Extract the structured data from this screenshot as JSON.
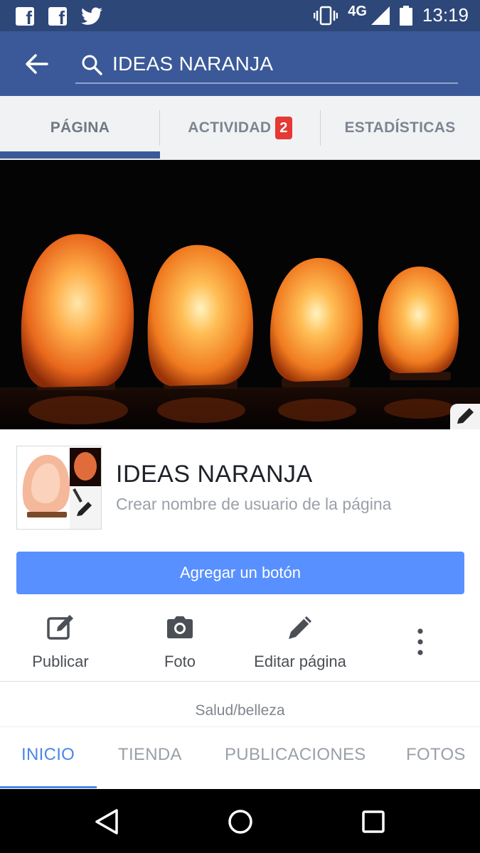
{
  "status_bar": {
    "network": "4G",
    "time": "13:19",
    "icons": [
      "facebook-icon",
      "facebook-icon",
      "twitter-icon",
      "vibrate-icon",
      "signal-icon",
      "battery-icon"
    ]
  },
  "header": {
    "search_text": "IDEAS NARANJA",
    "back_icon": "arrow-left-icon",
    "search_icon": "search-icon"
  },
  "page_tabs": [
    {
      "label": "PÁGINA",
      "active": true
    },
    {
      "label": "ACTIVIDAD",
      "badge": "2"
    },
    {
      "label": "ESTADÍSTICAS"
    }
  ],
  "profile": {
    "name": "IDEAS NARANJA",
    "username_prompt": "Crear nombre de usuario de la página"
  },
  "cta": {
    "label": "Agregar un botón"
  },
  "actions": [
    {
      "label": "Publicar",
      "icon": "compose-icon"
    },
    {
      "label": "Foto",
      "icon": "camera-icon"
    },
    {
      "label": "Editar página",
      "icon": "pencil-icon"
    }
  ],
  "category": "Salud/belleza",
  "content_tabs": [
    {
      "label": "INICIO",
      "active": true
    },
    {
      "label": "TIENDA"
    },
    {
      "label": "PUBLICACIONES"
    },
    {
      "label": "FOTOS"
    }
  ],
  "colors": {
    "status_bar": "#2e4779",
    "header": "#3b5998",
    "cta": "#5890ff",
    "active_tab": "#4a86e8",
    "badge": "#e53935"
  }
}
